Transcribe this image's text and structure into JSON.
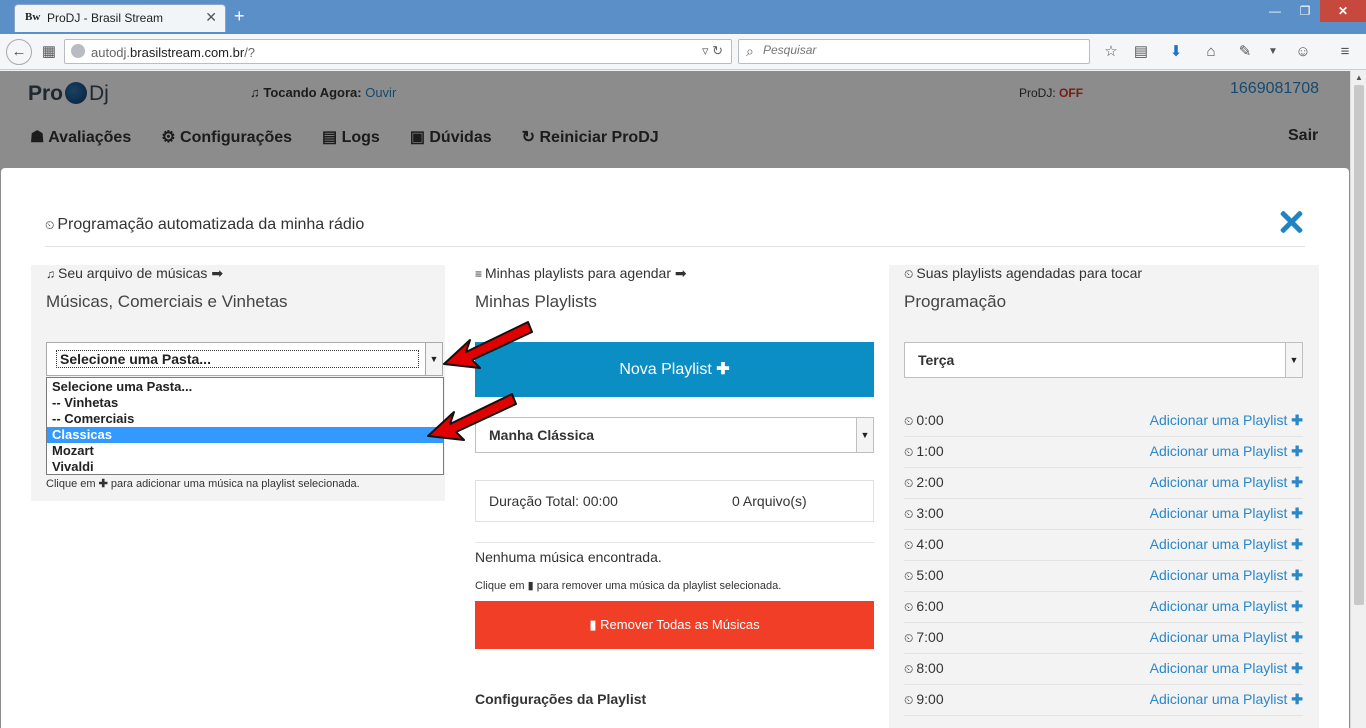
{
  "browser": {
    "tab_title": "ProDJ - Brasil Stream",
    "favicon_text": "Bw",
    "url_prefix": "autodj.",
    "url_domain": "brasilstream.com.br",
    "url_suffix": "/?",
    "search_placeholder": "Pesquisar"
  },
  "site": {
    "logo_pro": "Pro",
    "logo_dj": "Dj",
    "now_playing_label": "Tocando Agora:",
    "now_playing_link": "Ouvir",
    "status_label": "ProDJ:",
    "status_value": "OFF",
    "account_id": "1669081708",
    "menu": [
      "Avaliações",
      "Configurações",
      "Logs",
      "Dúvidas",
      "Reiniciar ProDJ"
    ],
    "logout": "Sair"
  },
  "modal": {
    "title": "Programação automatizada da minha rádio",
    "library": {
      "label": "Seu arquivo de músicas",
      "title": "Músicas, Comerciais e Vinhetas",
      "selected": "Selecione uma Pasta...",
      "options": [
        "Selecione uma Pasta...",
        "-- Vinhetas",
        "-- Comerciais",
        "Classicas",
        "Mozart",
        "Vivaldi"
      ],
      "highlighted_option": "Classicas",
      "hint_before": "Clique em",
      "hint_after": "para adicionar uma música na playlist selecionada."
    },
    "playlists": {
      "label": "Minhas playlists para agendar",
      "title": "Minhas Playlists",
      "new_button": "Nova Playlist",
      "selected_playlist": "Manha Clássica",
      "duration": "Duração Total: 00:00",
      "file_count": "0 Arquivo(s)",
      "empty": "Nenhuma música encontrada.",
      "hint_before": "Clique em",
      "hint_after": "para remover uma música da playlist selecionada.",
      "remove_all": "Remover Todas as Músicas",
      "settings_title": "Configurações da Playlist"
    },
    "schedule": {
      "label": "Suas playlists agendadas para tocar",
      "title": "Programação",
      "day": "Terça",
      "add_label": "Adicionar uma Playlist",
      "slots": [
        "0:00",
        "1:00",
        "2:00",
        "3:00",
        "4:00",
        "5:00",
        "6:00",
        "7:00",
        "8:00",
        "9:00"
      ]
    }
  },
  "colors": {
    "accent": "#0a8ec4",
    "danger": "#f03f26",
    "link": "#2a87c8",
    "annotation_arrow": "#e00000"
  }
}
